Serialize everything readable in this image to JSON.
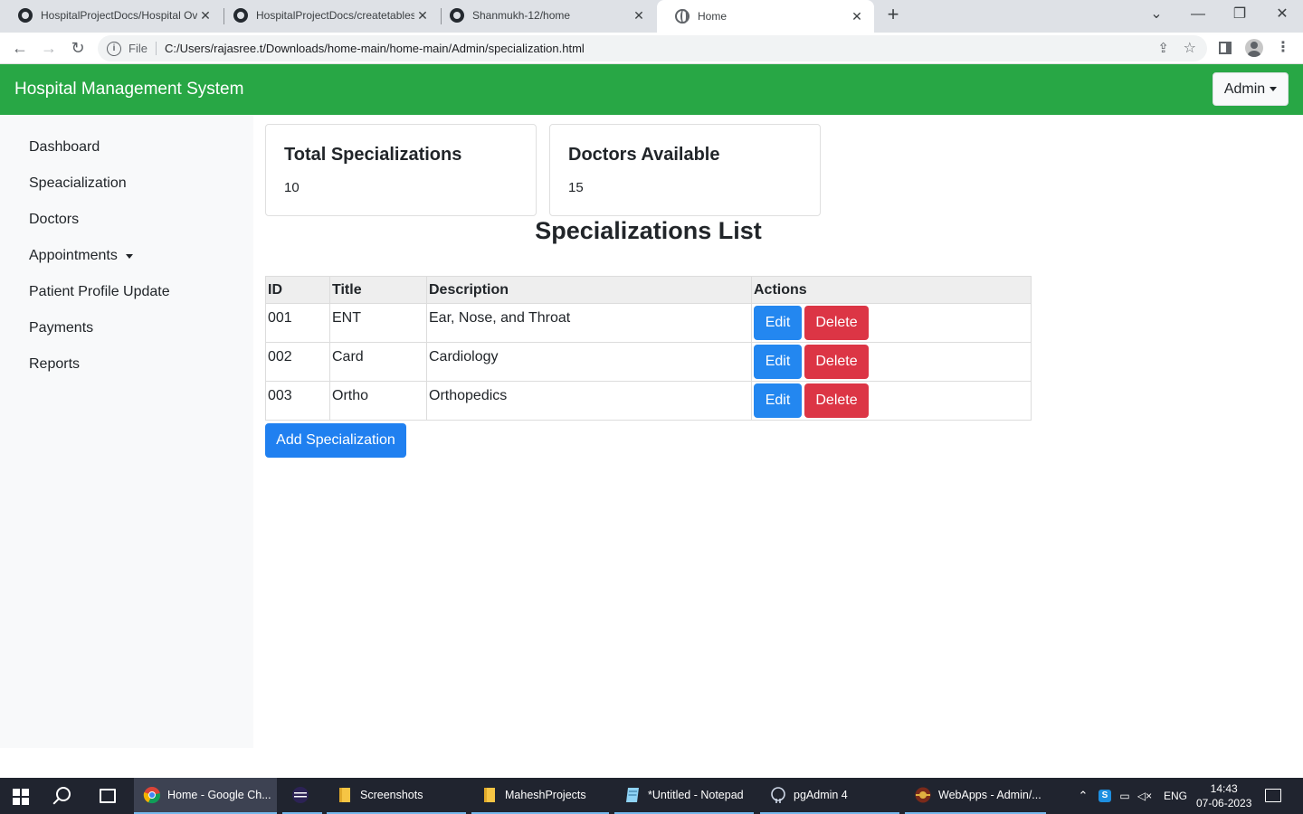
{
  "browser": {
    "tabs": [
      {
        "title": "HospitalProjectDocs/Hospital Ov",
        "favicon": "github-icon"
      },
      {
        "title": "HospitalProjectDocs/createtables",
        "favicon": "github-icon"
      },
      {
        "title": "Shanmukh-12/home",
        "favicon": "github-icon"
      },
      {
        "title": "Home",
        "favicon": "globe-icon",
        "active": true
      }
    ],
    "address_prefix": "File",
    "url": "C:/Users/rajasree.t/Downloads/home-main/home-main/Admin/specialization.html"
  },
  "navbar": {
    "brand": "Hospital Management System",
    "user_menu": "Admin",
    "color": "#28a745"
  },
  "sidebar": {
    "items": [
      {
        "label": "Dashboard"
      },
      {
        "label": "Speacialization"
      },
      {
        "label": "Doctors"
      },
      {
        "label": "Appointments",
        "dropdown": true
      },
      {
        "label": "Patient Profile Update"
      },
      {
        "label": "Payments"
      },
      {
        "label": "Reports"
      }
    ]
  },
  "stats": [
    {
      "title": "Total Specializations",
      "value": "10"
    },
    {
      "title": "Doctors Available",
      "value": "15"
    }
  ],
  "specializations": {
    "heading": "Specializations List",
    "columns": [
      "ID",
      "Title",
      "Description",
      "Actions"
    ],
    "rows": [
      {
        "id": "001",
        "title": "ENT",
        "description": "Ear, Nose, and Throat"
      },
      {
        "id": "002",
        "title": "Card",
        "description": "Cardiology"
      },
      {
        "id": "003",
        "title": "Ortho",
        "description": "Orthopedics"
      }
    ],
    "edit_label": "Edit",
    "delete_label": "Delete",
    "add_label": "Add Specialization"
  },
  "taskbar": {
    "apps": [
      {
        "label": "Home - Google Ch...",
        "icon": "chrome-icon",
        "active": true
      },
      {
        "label": "",
        "icon": "eclipse-icon"
      },
      {
        "label": "Screenshots",
        "icon": "folder-icon"
      },
      {
        "label": "MaheshProjects",
        "icon": "folder-icon"
      },
      {
        "label": "*Untitled - Notepad",
        "icon": "notepad-icon"
      },
      {
        "label": "pgAdmin 4",
        "icon": "elephant-icon"
      },
      {
        "label": "WebApps - Admin/...",
        "icon": "webapps-icon"
      }
    ],
    "language": "ENG",
    "time": "14:43",
    "date": "07-06-2023"
  }
}
